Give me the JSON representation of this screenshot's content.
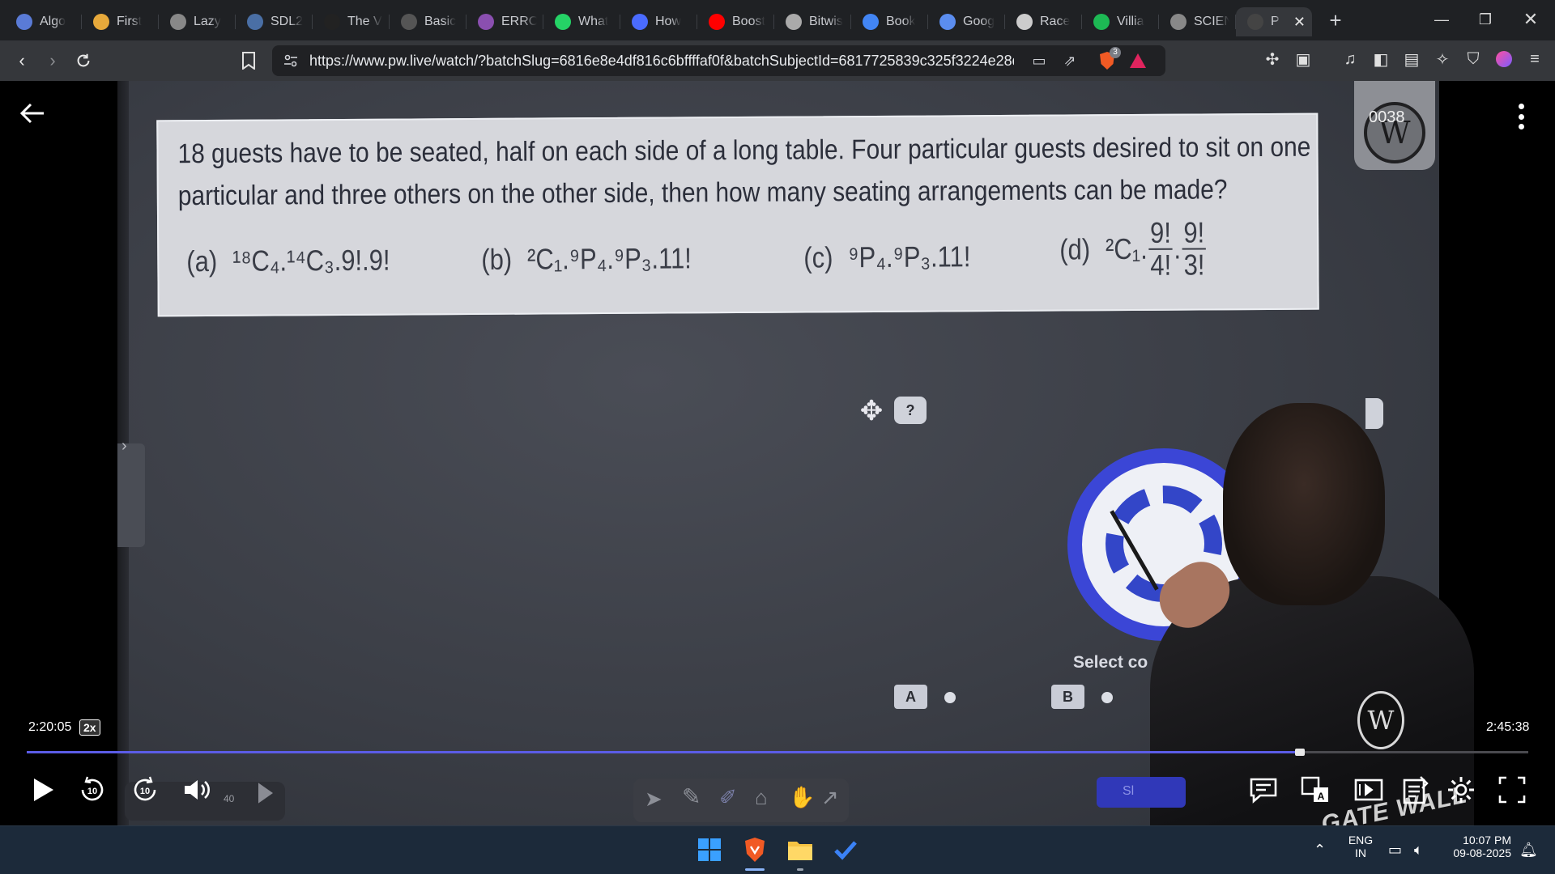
{
  "browser": {
    "tabs": [
      {
        "label": "Algo",
        "icon": "algo-icon",
        "color": "#5a7bd6"
      },
      {
        "label": "First",
        "icon": "first-icon",
        "color": "#e7a93b"
      },
      {
        "label": "Lazy",
        "icon": "globe-icon",
        "color": "#888888"
      },
      {
        "label": "SDL2",
        "icon": "sdl-icon",
        "color": "#4a6fa5"
      },
      {
        "label": "The V",
        "icon": "w3-icon",
        "color": "#222222"
      },
      {
        "label": "Basic",
        "icon": "basic-icon",
        "color": "#555555"
      },
      {
        "label": "ERRO",
        "icon": "erro-icon",
        "color": "#8a4fb0"
      },
      {
        "label": "What",
        "icon": "whatsapp-icon",
        "color": "#25d366"
      },
      {
        "label": "How",
        "icon": "how-icon",
        "color": "#4a6bff"
      },
      {
        "label": "Boost",
        "icon": "youtube-icon",
        "color": "#ff0000"
      },
      {
        "label": "Bitwis",
        "icon": "bitwise-icon",
        "color": "#aaaaaa"
      },
      {
        "label": "Book",
        "icon": "google-icon",
        "color": "#4285f4"
      },
      {
        "label": "Goog",
        "icon": "gemini-icon",
        "color": "#5b8def"
      },
      {
        "label": "Race",
        "icon": "openai-icon",
        "color": "#cccccc"
      },
      {
        "label": "Villia",
        "icon": "spotify-icon",
        "color": "#1db954"
      },
      {
        "label": "SCIEN",
        "icon": "globe-icon",
        "color": "#888888"
      },
      {
        "label": "P",
        "icon": "pw-icon",
        "color": "#444444",
        "active": true
      }
    ],
    "new_tab_label": "+",
    "url": "https://www.pw.live/watch/?batchSlug=6816e8e4df816c6bffffaf0f&batchSubjectId=6817725839c325f3224e28d...",
    "brave_badge_count": "3"
  },
  "video": {
    "question": {
      "text_line1": "18 guests have to be seated, half on each side of a long table. Four particular guests desired to sit on one",
      "text_line2": "particular and three others on the other side, then how many seating arrangements can be made?",
      "options": [
        {
          "label": "(a)",
          "text": "¹⁸C₄.¹⁴C₃.9!.9!"
        },
        {
          "label": "(b)",
          "text": "²C₁.⁹P₄.⁹P₃.11!"
        },
        {
          "label": "(c)",
          "text": "⁹P₄.⁹P₃.11!"
        },
        {
          "label": "(d)",
          "prefix": "²C₁.",
          "frac1_num": "9!",
          "frac1_den": "4!",
          "frac2_num": "9!",
          "frac2_den": "3!"
        }
      ]
    },
    "help_label": "?",
    "select_label": "Select co",
    "choices": [
      {
        "label": "A"
      },
      {
        "label": "B"
      }
    ],
    "submit_label": "Sl",
    "logo_text": "W",
    "logo_number": "0038",
    "badge_text": "W",
    "gate_wall_text": "GATE WALL"
  },
  "player": {
    "current_time": "2:20:05",
    "speed": "2x",
    "total_time": "2:45:38",
    "progress_fraction": 0.848,
    "rewind_label": "10",
    "forward_label": "10",
    "volume_small_label": "40"
  },
  "taskbar": {
    "language": "ENG",
    "region": "IN",
    "time": "10:07 PM",
    "date": "09-08-2025"
  }
}
